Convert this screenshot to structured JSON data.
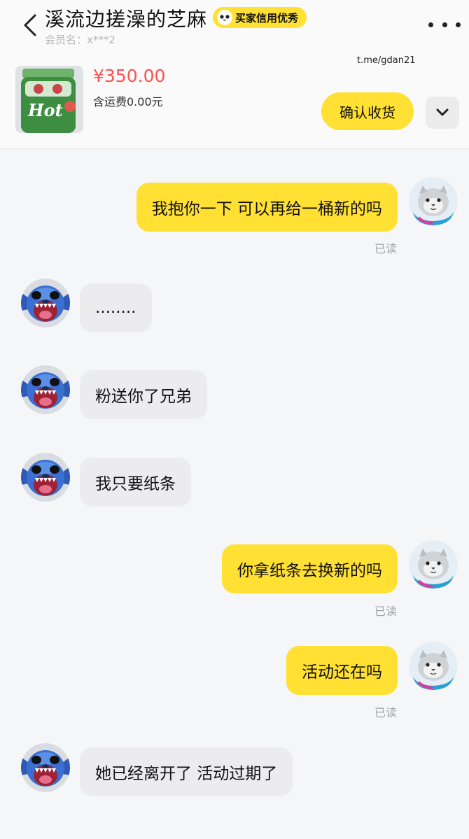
{
  "header": {
    "title": "溪流边搓澡的芝麻",
    "badge": "买家信用优秀",
    "member_label": "会员名：",
    "member_value": "x***2",
    "watermark": "t.me/gdan21"
  },
  "product": {
    "image_text": "Hot",
    "price": "¥350.00",
    "shipping": "含运费0.00元",
    "confirm_label": "确认收货"
  },
  "messages": [
    {
      "side": "out",
      "text": "我抱你一下 可以再给一桶新的吗",
      "status": "已读"
    },
    {
      "side": "in",
      "text": "........"
    },
    {
      "side": "in",
      "text": "粉送你了兄弟"
    },
    {
      "side": "in",
      "text": "我只要纸条"
    },
    {
      "side": "out",
      "text": "你拿纸条去换新的吗",
      "status": "已读"
    },
    {
      "side": "out",
      "text": "活动还在吗",
      "status": "已读"
    },
    {
      "side": "in",
      "text": "她已经离开了 活动过期了"
    }
  ],
  "colors": {
    "accent_yellow": "#ffe033",
    "price_red": "#ff4f4f",
    "bubble_grey": "#ececee",
    "background": "#f5f6f8"
  },
  "icons": {
    "back": "chevron-left-icon",
    "more": "more-dots-icon",
    "expand": "chevron-down-icon",
    "badge": "panda-face-icon",
    "self_avatar": "cat-avatar",
    "peer_avatar": "stitch-avatar"
  }
}
